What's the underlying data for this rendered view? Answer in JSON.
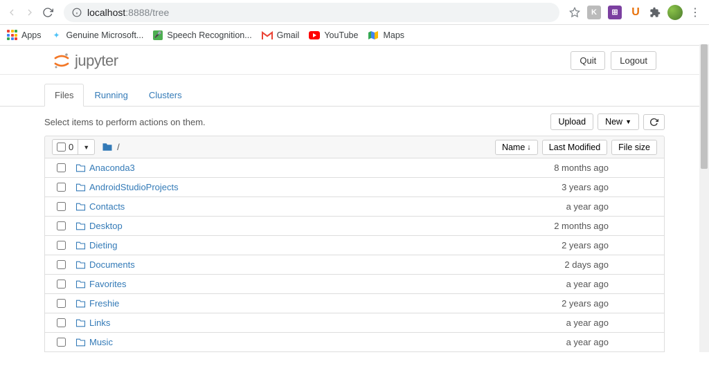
{
  "browser": {
    "url_host": "localhost",
    "url_port_path": ":8888/tree"
  },
  "bookmarks": {
    "apps": "Apps",
    "items": [
      {
        "label": "Genuine Microsoft..."
      },
      {
        "label": "Speech Recognition..."
      },
      {
        "label": "Gmail"
      },
      {
        "label": "YouTube"
      },
      {
        "label": "Maps"
      }
    ]
  },
  "header": {
    "logo_text": "jupyter",
    "quit": "Quit",
    "logout": "Logout"
  },
  "tabs": {
    "files": "Files",
    "running": "Running",
    "clusters": "Clusters"
  },
  "toolbar": {
    "hint": "Select items to perform actions on them.",
    "upload": "Upload",
    "new": "New"
  },
  "list_header": {
    "selected_count": "0",
    "breadcrumb_sep": "/",
    "name": "Name",
    "last_modified": "Last Modified",
    "file_size": "File size"
  },
  "files": [
    {
      "name": "Anaconda3",
      "modified": "8 months ago",
      "size": ""
    },
    {
      "name": "AndroidStudioProjects",
      "modified": "3 years ago",
      "size": ""
    },
    {
      "name": "Contacts",
      "modified": "a year ago",
      "size": ""
    },
    {
      "name": "Desktop",
      "modified": "2 months ago",
      "size": ""
    },
    {
      "name": "Dieting",
      "modified": "2 years ago",
      "size": ""
    },
    {
      "name": "Documents",
      "modified": "2 days ago",
      "size": ""
    },
    {
      "name": "Favorites",
      "modified": "a year ago",
      "size": ""
    },
    {
      "name": "Freshie",
      "modified": "2 years ago",
      "size": ""
    },
    {
      "name": "Links",
      "modified": "a year ago",
      "size": ""
    },
    {
      "name": "Music",
      "modified": "a year ago",
      "size": ""
    }
  ]
}
